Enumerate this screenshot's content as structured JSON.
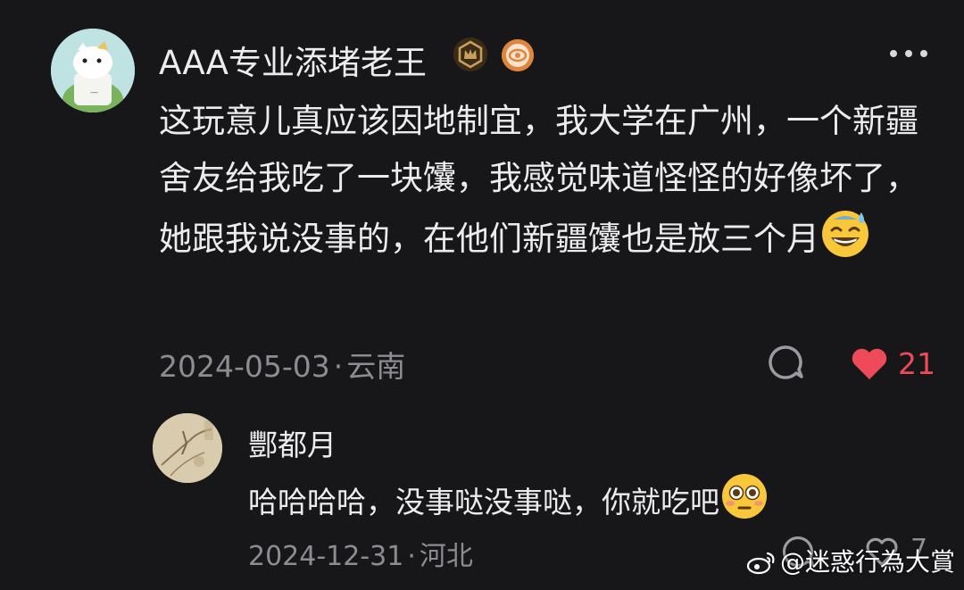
{
  "comments": [
    {
      "username": "AAA专业添堵老王",
      "text": "这玩意儿真应该因地制宜，我大学在广州，一个新疆舍友给我吃了一块馕，我感觉味道怪怪的好像坏了，她跟我说没事的，在他们新疆馕也是放三个月",
      "emoji": "grinning-sweat-emoji",
      "date": "2024-05-03",
      "separator": "·",
      "location": "云南",
      "like_count": "21",
      "badges": [
        "level-badge-icon",
        "eye-badge-icon"
      ]
    },
    {
      "username": "酆都月",
      "text": "哈哈哈哈，没事哒没事哒，你就吃吧",
      "emoji": "flushed-emoji",
      "date": "2024-12-31",
      "separator": "·",
      "location": "河北",
      "like_count": "7"
    }
  ],
  "watermark": "@迷惑行為大賞",
  "colors": {
    "background": "#17171a",
    "text": "#ececee",
    "meta": "#8c8c92",
    "like_active": "#ee4a58"
  }
}
